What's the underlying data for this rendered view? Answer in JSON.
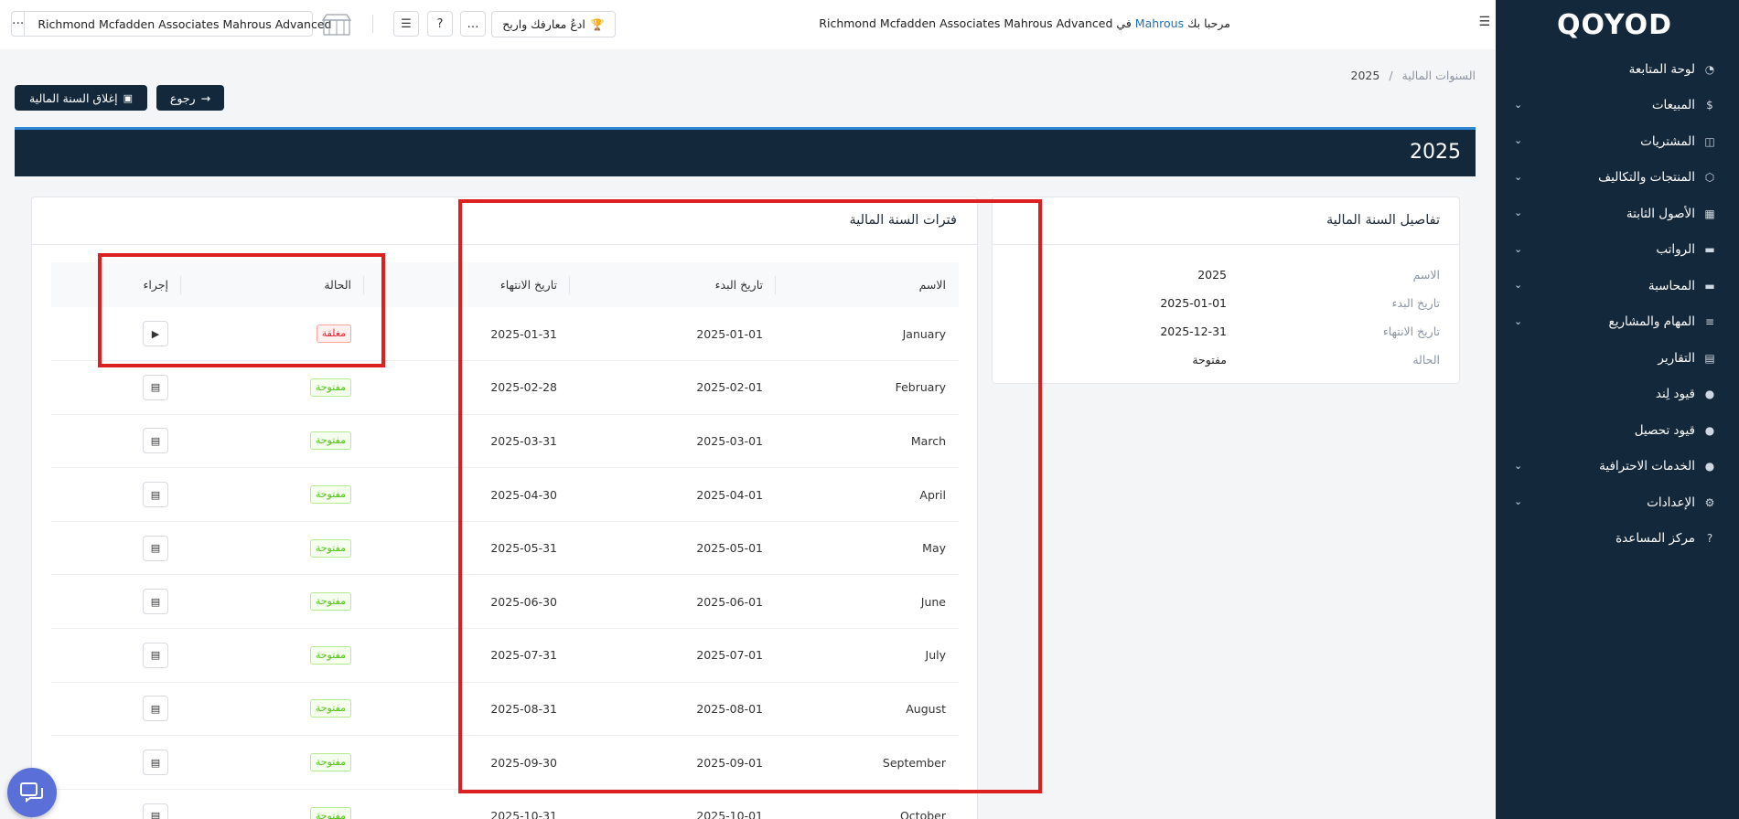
{
  "sidebar": {
    "logo": "QOYOD",
    "items": [
      {
        "label": "لوحة المتابعة",
        "icon": "dashboard-icon",
        "has_children": false
      },
      {
        "label": "المبيعات",
        "icon": "dollar-icon",
        "has_children": true
      },
      {
        "label": "المشتريات",
        "icon": "clipboard-icon",
        "has_children": true
      },
      {
        "label": "المنتجات والتكاليف",
        "icon": "box-icon",
        "has_children": true
      },
      {
        "label": "الأصول الثابتة",
        "icon": "grid-icon",
        "has_children": true
      },
      {
        "label": "الرواتب",
        "icon": "folder-icon",
        "has_children": true
      },
      {
        "label": "المحاسبة",
        "icon": "folder-icon",
        "has_children": true
      },
      {
        "label": "المهام والمشاريع",
        "icon": "tasks-icon",
        "has_children": true
      },
      {
        "label": "التقارير",
        "icon": "report-icon",
        "has_children": false
      },
      {
        "label": "قيود لِند",
        "icon": "q-icon",
        "has_children": false
      },
      {
        "label": "قيود تحصيل",
        "icon": "q-icon",
        "has_children": false
      },
      {
        "label": "الخدمات الاحترافية",
        "icon": "q-icon",
        "has_children": true
      },
      {
        "label": "الإعدادات",
        "icon": "gear-icon",
        "has_children": true
      },
      {
        "label": "مركز المساعدة",
        "icon": "help-icon",
        "has_children": false
      }
    ]
  },
  "topbar": {
    "company_name": "Richmond Mcfadden Associates Mahrous Advanced",
    "more_label": "···",
    "refer_label": "ادعُ معارفك واربح",
    "welcome_prefix": "مرحبا بك",
    "welcome_user": "Mahrous",
    "welcome_in": "في",
    "welcome_company": "Richmond Mcfadden Associates Mahrous Advanced"
  },
  "breadcrumb": {
    "parent": "السنوات المالية",
    "separator": "/",
    "current": "2025"
  },
  "actions": {
    "close_year_label": "إغلاق السنة المالية",
    "back_label": "رجوع"
  },
  "year_band": {
    "title": "2025"
  },
  "details": {
    "title": "تفاصيل السنة المالية",
    "rows": [
      {
        "key": "الاسم",
        "value": "2025"
      },
      {
        "key": "تاريخ البدء",
        "value": "2025-01-01"
      },
      {
        "key": "تاريخ الانتهاء",
        "value": "2025-12-31"
      },
      {
        "key": "الحالة",
        "value": "مفتوحة"
      }
    ]
  },
  "periods": {
    "title": "فترات السنة المالية",
    "headers": {
      "name": "الاسم",
      "start": "تاريخ البدء",
      "end": "تاريخ الانتهاء",
      "status": "الحالة",
      "action": "إجراء"
    },
    "rows": [
      {
        "name": "January",
        "start": "2025-01-01",
        "end": "2025-01-31",
        "status": "مغلقة",
        "state": "closed"
      },
      {
        "name": "February",
        "start": "2025-02-01",
        "end": "2025-02-28",
        "status": "مفتوحة",
        "state": "open"
      },
      {
        "name": "March",
        "start": "2025-03-01",
        "end": "2025-03-31",
        "status": "مفتوحة",
        "state": "open"
      },
      {
        "name": "April",
        "start": "2025-04-01",
        "end": "2025-04-30",
        "status": "مفتوحة",
        "state": "open"
      },
      {
        "name": "May",
        "start": "2025-05-01",
        "end": "2025-05-31",
        "status": "مفتوحة",
        "state": "open"
      },
      {
        "name": "June",
        "start": "2025-06-01",
        "end": "2025-06-30",
        "status": "مفتوحة",
        "state": "open"
      },
      {
        "name": "July",
        "start": "2025-07-01",
        "end": "2025-07-31",
        "status": "مفتوحة",
        "state": "open"
      },
      {
        "name": "August",
        "start": "2025-08-01",
        "end": "2025-08-31",
        "status": "مفتوحة",
        "state": "open"
      },
      {
        "name": "September",
        "start": "2025-09-01",
        "end": "2025-09-30",
        "status": "مفتوحة",
        "state": "open"
      },
      {
        "name": "October",
        "start": "2025-10-01",
        "end": "2025-10-31",
        "status": "مفتوحة",
        "state": "open"
      }
    ]
  },
  "colors": {
    "sidebar_bg": "#14283b",
    "accent": "#2e86d4",
    "highlight": "#dc1f1f",
    "open_badge": "#52c41a",
    "closed_badge": "#f5222d"
  }
}
